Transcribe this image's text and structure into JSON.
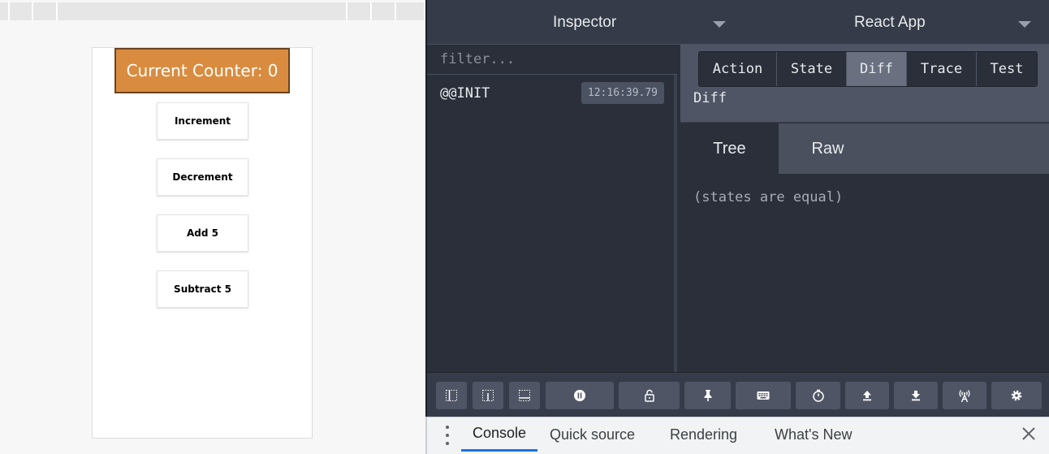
{
  "app": {
    "counter_label": "Current Counter: 0",
    "buttons": [
      {
        "label": "Increment"
      },
      {
        "label": "Decrement"
      },
      {
        "label": "Add 5"
      },
      {
        "label": "Subtract 5"
      }
    ]
  },
  "devtools": {
    "header": {
      "monitor": "Inspector",
      "instance": "React App"
    },
    "filter_placeholder": "filter...",
    "actions": [
      {
        "name": "@@INIT",
        "time": "12:16:39.79"
      }
    ],
    "tabs": [
      "Action",
      "State",
      "Diff",
      "Trace",
      "Test"
    ],
    "active_tab": "Diff",
    "tab_title": "Diff",
    "sub_tabs": [
      "Tree",
      "Raw"
    ],
    "active_sub_tab": "Tree",
    "diff_message": "(states are equal)",
    "toolbar": [
      "dock-left-icon",
      "dock-bottom-icon",
      "dock-right-icon",
      "pause-icon",
      "lock-icon",
      "pin-icon",
      "keyboard-icon",
      "timer-icon",
      "upload-icon",
      "download-icon",
      "broadcast-icon",
      "gear-icon"
    ]
  },
  "drawer": {
    "tabs": [
      "Console",
      "Quick source",
      "Rendering",
      "What's New"
    ],
    "active_tab": "Console"
  },
  "colors": {
    "counter_bg": "#d98c3f",
    "devtools_bg": "#2a2f3a",
    "active_tab_underline": "#1a73e8"
  }
}
